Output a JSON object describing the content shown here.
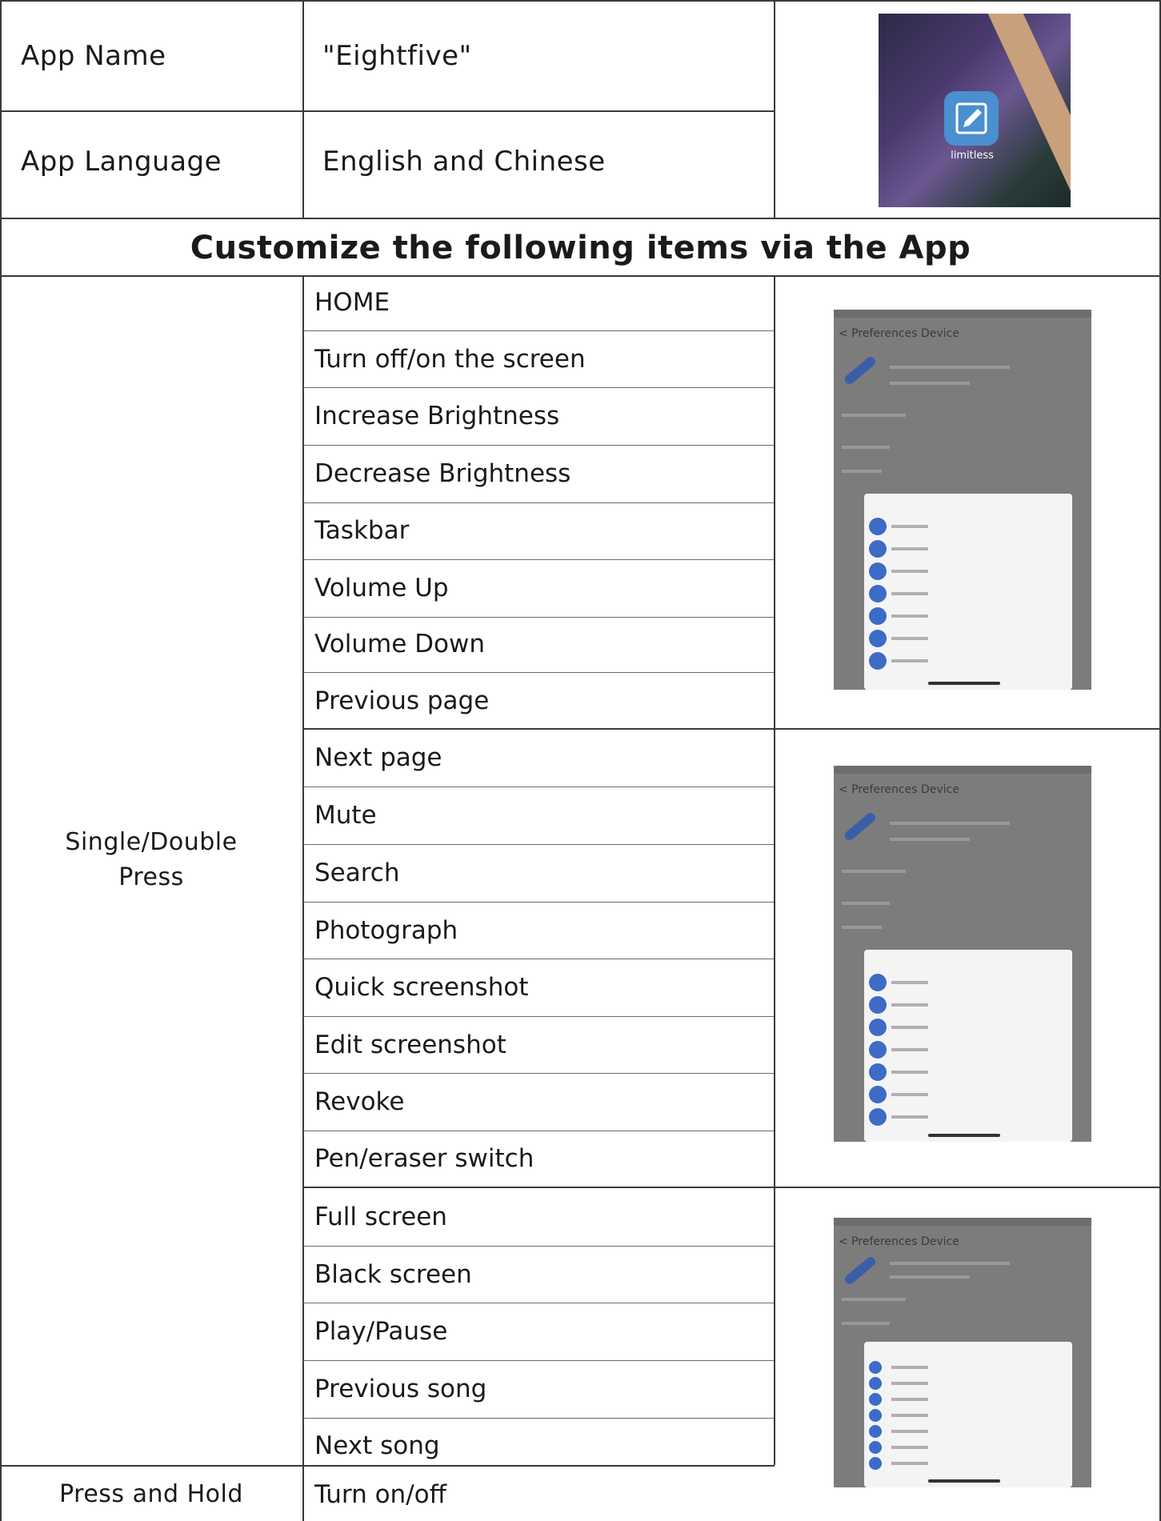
{
  "rows": {
    "app_name_label": "App Name",
    "app_name_value": "\"Eightfive\"",
    "app_language_label": "App Language",
    "app_language_value": "English and Chinese"
  },
  "app_icon": {
    "label": "limitless",
    "icon": "pencil-icon"
  },
  "section_title": "Customize the following items via the App",
  "single_double": {
    "label_line1": "Single/Double",
    "label_line2": "Press",
    "items": [
      "HOME",
      "Turn off/on the screen",
      "Increase Brightness",
      "Decrease Brightness",
      "Taskbar",
      "Volume Up",
      "Volume Down",
      "Previous page",
      "Next page",
      "Mute",
      "Search",
      "Photograph",
      "Quick screenshot",
      "Edit screenshot",
      "Revoke",
      "Pen/eraser switch",
      "Full screen",
      "Black screen",
      "Play/Pause",
      "Previous song",
      "Next song"
    ]
  },
  "press_hold": {
    "label": "Press and Hold",
    "items": [
      "Turn on/off"
    ]
  },
  "screenshots": [
    {
      "header": "< Preferences Device"
    },
    {
      "header": "< Preferences Device"
    },
    {
      "header": "< Preferences Device"
    }
  ],
  "colors": {
    "grid": "#3a3a3a",
    "accent": "#3d6bc6",
    "screenshot_bg": "#7c7c7c"
  }
}
